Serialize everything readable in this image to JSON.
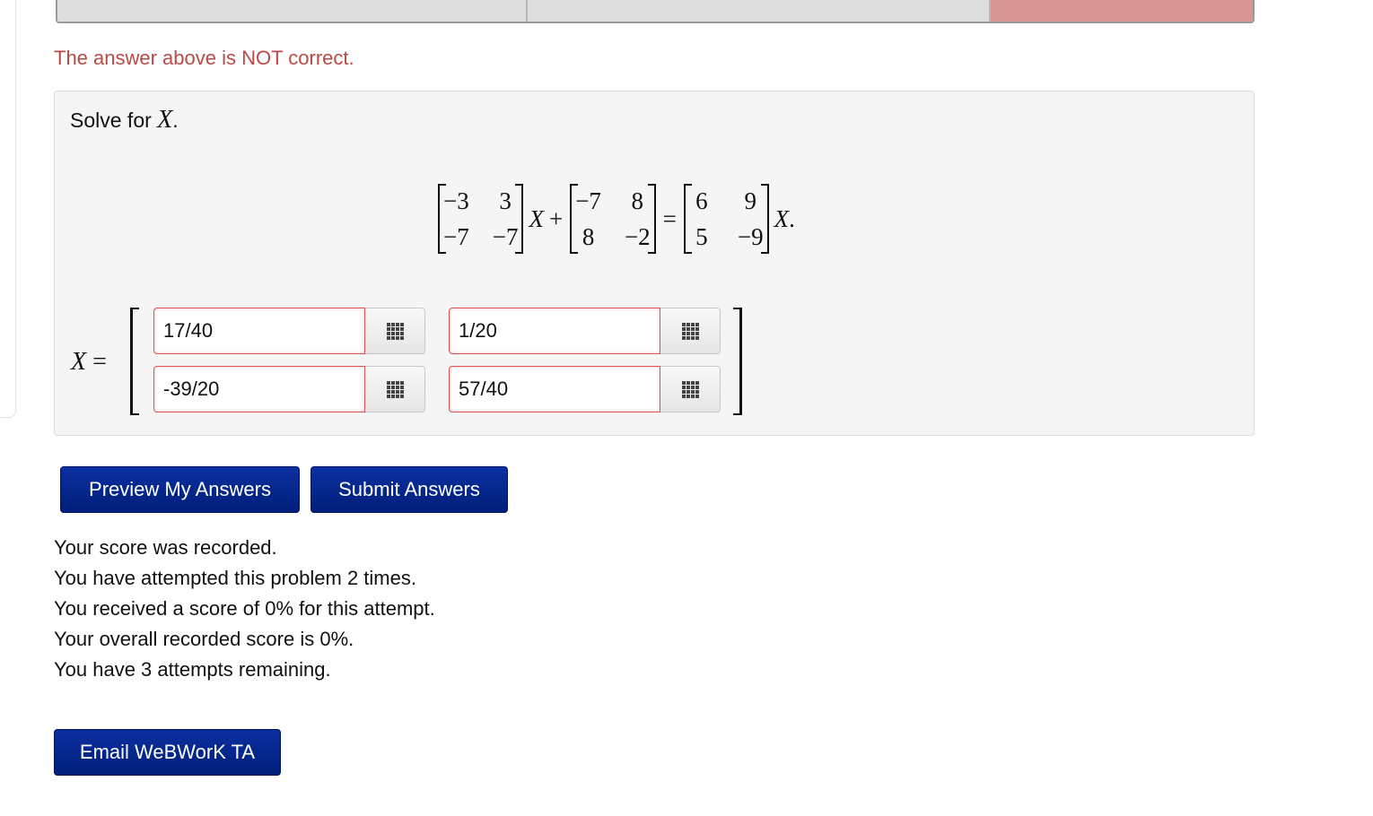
{
  "feedback": {
    "incorrect_message": "The answer above is NOT correct."
  },
  "problem": {
    "prompt_text": "Solve for ",
    "prompt_var": "X",
    "prompt_end": ".",
    "equation": {
      "A": [
        [
          "−3",
          "3"
        ],
        [
          "−7",
          "−7"
        ]
      ],
      "B": [
        [
          "−7",
          "8"
        ],
        [
          "8",
          "−2"
        ]
      ],
      "C": [
        [
          "6",
          "9"
        ],
        [
          "5",
          "−9"
        ]
      ],
      "x_symbol": "X",
      "plus": "+",
      "equals": "=",
      "end": "."
    }
  },
  "answer": {
    "label_var": "X",
    "label_eq": " =",
    "cells": [
      {
        "row": 0,
        "col": 0,
        "value": "17/40"
      },
      {
        "row": 0,
        "col": 1,
        "value": "1/20"
      },
      {
        "row": 1,
        "col": 0,
        "value": "-39/20"
      },
      {
        "row": 1,
        "col": 1,
        "value": "57/40"
      }
    ],
    "matrix_button_icon": "matrix-grid-icon"
  },
  "buttons": {
    "preview": "Preview My Answers",
    "submit": "Submit Answers",
    "email": "Email WeBWorK TA"
  },
  "status": {
    "lines": [
      "Your score was recorded.",
      "You have attempted this problem 2 times.",
      "You received a score of 0% for this attempt.",
      "Your overall recorded score is 0%.",
      "You have 3 attempts remaining."
    ]
  },
  "colors": {
    "error_text": "#b94a48",
    "button_blue": "#001f7a",
    "incorrect_cell": "#d99595"
  }
}
